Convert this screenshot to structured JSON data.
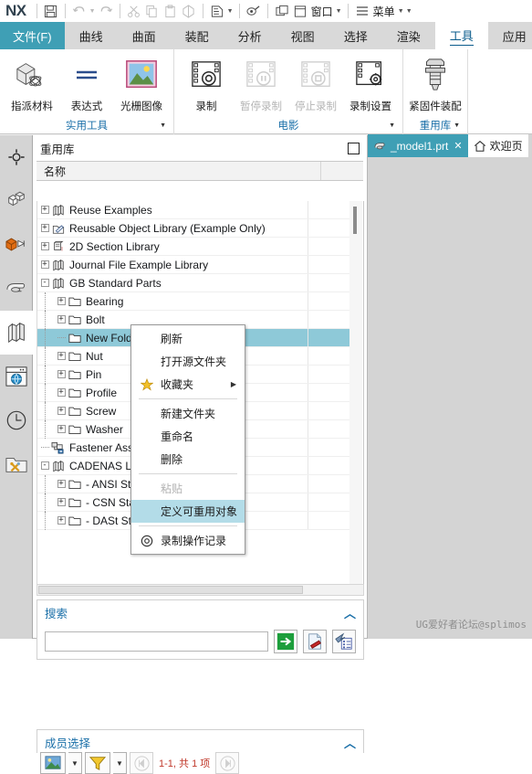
{
  "titlebar": {
    "logo": "NX",
    "buttons": [
      {
        "name": "save-button",
        "icon": "save",
        "label": ""
      },
      {
        "name": "undo-button",
        "icon": "undo",
        "label": ""
      },
      {
        "name": "redo-button",
        "icon": "redo",
        "label": ""
      },
      {
        "name": "cut-button",
        "icon": "cut",
        "label": ""
      },
      {
        "name": "copy-button",
        "icon": "copy",
        "label": ""
      },
      {
        "name": "paste-button",
        "icon": "paste",
        "label": ""
      },
      {
        "name": "paste-special-button",
        "icon": "paste-special",
        "label": ""
      },
      {
        "name": "undo-list-button",
        "icon": "undo-list",
        "label": ""
      },
      {
        "name": "touch-mode-button",
        "icon": "touch",
        "label": ""
      },
      {
        "name": "window-tile-button",
        "icon": "tile",
        "label": ""
      },
      {
        "name": "window-single-button",
        "icon": "single-window",
        "label": ""
      }
    ],
    "window_menu": "窗口",
    "menu_label": "菜单"
  },
  "tabs": [
    {
      "label": "文件(F)",
      "state": "file"
    },
    {
      "label": "曲线",
      "state": "normal"
    },
    {
      "label": "曲面",
      "state": "normal"
    },
    {
      "label": "装配",
      "state": "normal"
    },
    {
      "label": "分析",
      "state": "normal"
    },
    {
      "label": "视图",
      "state": "normal"
    },
    {
      "label": "选择",
      "state": "normal"
    },
    {
      "label": "渲染",
      "state": "normal"
    },
    {
      "label": "工具",
      "state": "active"
    },
    {
      "label": "应用",
      "state": "normal"
    }
  ],
  "ribbon": {
    "groups": [
      {
        "title": "实用工具",
        "has_dropdown": true,
        "commands": [
          {
            "label": "指派材料",
            "icon": "assign-material",
            "enabled": true
          },
          {
            "label": "表达式",
            "icon": "expression",
            "enabled": true
          },
          {
            "label": "光栅图像",
            "icon": "raster-image",
            "enabled": true
          }
        ]
      },
      {
        "title": "电影",
        "has_dropdown": true,
        "commands": [
          {
            "label": "录制",
            "icon": "record",
            "enabled": true
          },
          {
            "label": "暂停录制",
            "icon": "pause-record",
            "enabled": false
          },
          {
            "label": "停止录制",
            "icon": "stop-record",
            "enabled": false
          },
          {
            "label": "录制设置",
            "icon": "record-settings",
            "enabled": true
          }
        ]
      },
      {
        "title": "重用库",
        "has_dropdown": true,
        "commands": [
          {
            "label": "紧固件装配",
            "icon": "fastener-assembly",
            "enabled": true
          }
        ]
      }
    ]
  },
  "resource_bar": {
    "items": [
      {
        "name": "sidebar-item-constraint-navigator",
        "icon": "target-icon",
        "active": false
      },
      {
        "name": "sidebar-item-assembly-navigator",
        "icon": "assembly-icon",
        "active": false
      },
      {
        "name": "sidebar-item-part-navigator",
        "icon": "part-navigator-icon",
        "active": false
      },
      {
        "name": "sidebar-item-model-view",
        "icon": "model-view-icon",
        "active": false
      },
      {
        "name": "sidebar-item-reuse-library",
        "icon": "reuse-library-icon",
        "active": true
      },
      {
        "name": "sidebar-item-web-browser",
        "icon": "web-browser-icon",
        "active": false
      },
      {
        "name": "sidebar-item-history",
        "icon": "clock-icon",
        "active": false
      },
      {
        "name": "sidebar-item-roles",
        "icon": "roles-tools-icon",
        "active": false
      }
    ]
  },
  "dock": {
    "title": "重用库",
    "pin_icon": "maximize-icon",
    "grid_header": {
      "name_column": "名称",
      "second_column": ""
    },
    "tree": [
      {
        "label": "Reuse Examples",
        "level": 0,
        "expander": "+",
        "icon": "library-icon"
      },
      {
        "label": "Reusable Object Library (Example Only)",
        "level": 0,
        "expander": "+",
        "icon": "reusable-object-icon"
      },
      {
        "label": "2D Section Library",
        "level": 0,
        "expander": "+",
        "icon": "section-library-icon"
      },
      {
        "label": "Journal File Example Library",
        "level": 0,
        "expander": "+",
        "icon": "library-icon"
      },
      {
        "label": "GB Standard Parts",
        "level": 0,
        "expander": "-",
        "icon": "library-icon"
      },
      {
        "label": "Bearing",
        "level": 1,
        "expander": "+",
        "icon": "folder-icon"
      },
      {
        "label": "Bolt",
        "level": 1,
        "expander": "+",
        "icon": "folder-icon"
      },
      {
        "label": "New Folder",
        "level": 1,
        "expander": "",
        "icon": "folder-icon",
        "selected": true
      },
      {
        "label": "Nut",
        "level": 1,
        "expander": "+",
        "icon": "folder-icon"
      },
      {
        "label": "Pin",
        "level": 1,
        "expander": "+",
        "icon": "folder-icon"
      },
      {
        "label": "Profile",
        "level": 1,
        "expander": "+",
        "icon": "folder-icon"
      },
      {
        "label": "Screw",
        "level": 1,
        "expander": "+",
        "icon": "folder-icon"
      },
      {
        "label": "Washer",
        "level": 1,
        "expander": "+",
        "icon": "folder-icon"
      },
      {
        "label": "Fastener Assembly Library",
        "level": 0,
        "expander": "",
        "icon": "fastener-library-icon"
      },
      {
        "label": "CADENAS Library",
        "level": 0,
        "expander": "-",
        "icon": "library-icon"
      },
      {
        "label": "- ANSI Standard",
        "level": 1,
        "expander": "+",
        "icon": "folder-icon"
      },
      {
        "label": "- CSN Standard",
        "level": 1,
        "expander": "+",
        "icon": "folder-icon"
      },
      {
        "label": "- DASt Standard",
        "level": 1,
        "expander": "+",
        "icon": "folder-icon"
      }
    ]
  },
  "context_menu": {
    "items": [
      {
        "label": "刷新",
        "icon": "",
        "state": "normal",
        "submenu": false
      },
      {
        "label": "打开源文件夹",
        "icon": "",
        "state": "normal",
        "submenu": false
      },
      {
        "label": "收藏夹",
        "icon": "star-icon",
        "state": "normal",
        "submenu": true
      },
      {
        "label": "__sep__",
        "icon": "",
        "state": "separator",
        "submenu": false
      },
      {
        "label": "新建文件夹",
        "icon": "",
        "state": "normal",
        "submenu": false
      },
      {
        "label": "重命名",
        "icon": "",
        "state": "normal",
        "submenu": false
      },
      {
        "label": "删除",
        "icon": "",
        "state": "normal",
        "submenu": false
      },
      {
        "label": "__sep__",
        "icon": "",
        "state": "separator",
        "submenu": false
      },
      {
        "label": "粘贴",
        "icon": "",
        "state": "disabled",
        "submenu": false
      },
      {
        "label": "定义可重用对象",
        "icon": "",
        "state": "highlighted",
        "submenu": false
      },
      {
        "label": "__sep__",
        "icon": "",
        "state": "separator",
        "submenu": false
      },
      {
        "label": "录制操作记录",
        "icon": "record-icon",
        "state": "normal",
        "submenu": false
      }
    ]
  },
  "search": {
    "title": "搜索",
    "collapse_icon": "chevron-up-icon",
    "value": "",
    "placeholder": "",
    "buttons": [
      {
        "name": "search-go-button",
        "icon": "green-arrow-icon"
      },
      {
        "name": "clear-search-button",
        "icon": "clear-icon"
      },
      {
        "name": "advanced-search-button",
        "icon": "advanced-search-icon"
      }
    ]
  },
  "member_select": {
    "title": "成员选择",
    "collapse_icon": "chevron-up-icon",
    "view_mode_label": "",
    "filter_label": "",
    "page_info": "1-1, 共 1 项",
    "prev_label": "",
    "next_label": ""
  },
  "document_tabs": [
    {
      "label": "_model1.prt",
      "icon": "part-icon",
      "active": true,
      "close": "✕"
    },
    {
      "label": "欢迎页",
      "icon": "home-icon",
      "active": false,
      "close": ""
    }
  ],
  "watermark": "UG爱好者论坛@splimos",
  "colors": {
    "accent_teal": "#3f9fb5",
    "tab_link": "#1a6fa8",
    "selection": "#8ec9d8",
    "menu_highlight": "#b3dce8",
    "ribbon_bg": "#ffffff",
    "tabstrip_bg": "#d9d9d9",
    "graphics_bg": "#d4d4d4"
  }
}
